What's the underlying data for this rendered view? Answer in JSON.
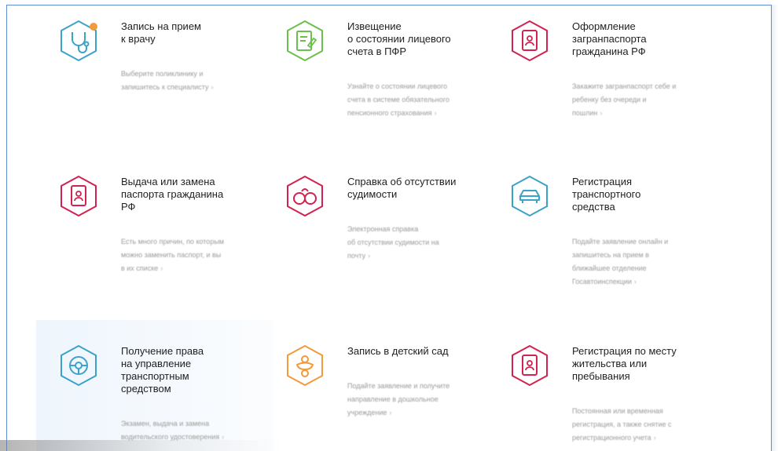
{
  "colors": {
    "frame_border": "#5b8fd6",
    "teal": "#3ba3c8",
    "green": "#6cbf4a",
    "crimson": "#d2224f",
    "orange": "#f29a3c"
  },
  "services": [
    {
      "title": "Запись на прием\nк врачу",
      "desc": "Выберите поликлинику и\nзапишитесь к специалисту",
      "arrow": "›",
      "icon": "stethoscope-icon"
    },
    {
      "title": "Извещение\nо состоянии лицевого\nсчета в ПФР",
      "desc": "Узнайте о состоянии лицевого\nсчета в системе обязательного\nпенсионного страхования",
      "arrow": "›",
      "icon": "document-edit-icon"
    },
    {
      "title": "Оформление\nзагранпаспорта\nгражданина РФ",
      "desc": "Закажите загранпаспорт себе и\nребенку без очереди и\nпошлин",
      "arrow": "›",
      "icon": "passport-icon"
    },
    {
      "title": "Выдача или замена\nпаспорта гражданина\nРФ",
      "desc": "Есть много причин, по которым\nможно заменить паспорт, и вы\nв их списке",
      "arrow": "›",
      "icon": "passport-person-icon"
    },
    {
      "title": "Справка об отсутствии\nсудимости",
      "desc": "Электронная справка\nоб отсутствии судимости на\nпочту",
      "arrow": "›",
      "icon": "handcuffs-icon"
    },
    {
      "title": "Регистрация\nтранспортного\nсредства",
      "desc": "Подайте заявление онлайн и\nзапишитесь на прием в\nближайшее отделение\nГосавтоинспекции",
      "arrow": "›",
      "icon": "car-icon"
    },
    {
      "title": "Получение права\nна управление\nтранспортным\nсредством",
      "desc": "Экзамен, выдача и замена\nводительского удостоверения",
      "arrow": "›",
      "icon": "steering-wheel-icon"
    },
    {
      "title": "Запись в детский сад",
      "desc": "Подайте заявление и получите\nнаправление в дошкольное\nучреждение",
      "arrow": "›",
      "icon": "pacifier-icon"
    },
    {
      "title": "Регистрация по месту\nжительства или\nпребывания",
      "desc": "Постоянная или временная\nрегистрация, а также снятие с\nрегистрационного учета",
      "arrow": "›",
      "icon": "passport-person-icon"
    }
  ]
}
